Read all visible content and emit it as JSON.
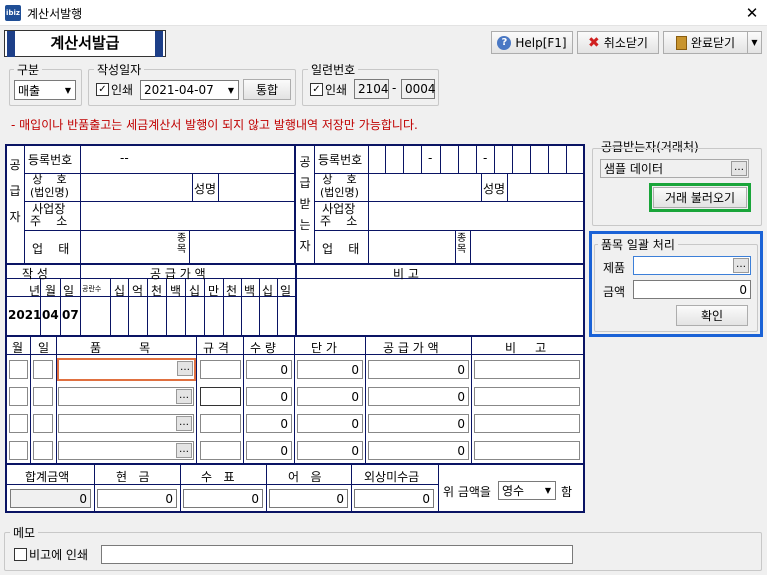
{
  "window": {
    "title": "계산서발행",
    "app_icon_text": "ibiz"
  },
  "heading": "계산서발급",
  "toolbar": {
    "help": "Help[F1]",
    "cancel": "취소닫기",
    "done": "완료닫기"
  },
  "gubun": {
    "label": "구분",
    "value": "매출"
  },
  "date": {
    "label": "작성일자",
    "print_label": "인쇄",
    "value": "2021-04-07",
    "merge_btn": "통합"
  },
  "serial": {
    "label": "일련번호",
    "print_label": "인쇄",
    "part1": "2104",
    "dash": "-",
    "part2": "0004"
  },
  "warning": "- 매입이나 반품출고는 세금계산서 발행이 되지 않고 발행내역 저장만 가능합니다.",
  "supplier": {
    "side": "공 급 자",
    "reg": "등록번호",
    "reg_value": "--",
    "name": "상    호\n(법인명)",
    "rep": "성명",
    "addr": "사업장\n주    소",
    "type": "업    태",
    "item": "종목"
  },
  "receiver": {
    "side": "공 급 받 는 자",
    "reg": "등록번호",
    "reg_dash1": "-",
    "reg_dash2": "-",
    "name": "상    호\n(법인명)",
    "rep": "성명",
    "addr": "사업장\n주    소",
    "type": "업    태",
    "item": "종목"
  },
  "amount_head": {
    "write": "작   성",
    "supply": "공   급   가   액",
    "remark": "비        고",
    "y": "년",
    "m": "월",
    "d": "일",
    "blank": "공란수",
    "digits": [
      "십",
      "억",
      "천",
      "백",
      "십",
      "만",
      "천",
      "백",
      "십",
      "일"
    ],
    "year": "2021",
    "month": "04",
    "day": "07"
  },
  "items": {
    "cols": [
      "월",
      "일",
      "품          목",
      "규 격",
      "수 량",
      "단 가",
      "공 급 가 액",
      "비     고"
    ],
    "rows": [
      {
        "qty": "0",
        "price": "0",
        "amount": "0"
      },
      {
        "qty": "0",
        "price": "0",
        "amount": "0"
      },
      {
        "qty": "0",
        "price": "0",
        "amount": "0"
      },
      {
        "qty": "0",
        "price": "0",
        "amount": "0"
      }
    ],
    "dots": "…"
  },
  "totals": {
    "labels": [
      "합계금액",
      "현   금",
      "수   표",
      "어   음",
      "외상미수금"
    ],
    "values": [
      "0",
      "0",
      "0",
      "0",
      "0"
    ],
    "phrase_pre": "위 금액을",
    "receipt": "영수",
    "phrase_post": "함"
  },
  "partner": {
    "label": "공급받는자(거래처)",
    "value": "샘플 데이터",
    "load_btn": "거래 불러오기"
  },
  "batch": {
    "label": "품목 일괄 처리",
    "product_label": "제품",
    "product_value": "",
    "amount_label": "금액",
    "amount_value": "0",
    "ok": "확인"
  },
  "memo": {
    "label": "메모",
    "print_label": "비고에 인쇄",
    "value": ""
  },
  "colors": {
    "navy": "#0a1464",
    "highlight_green": "#1aa53a",
    "highlight_blue": "#1a62d6",
    "highlight_orange": "#e07040"
  }
}
